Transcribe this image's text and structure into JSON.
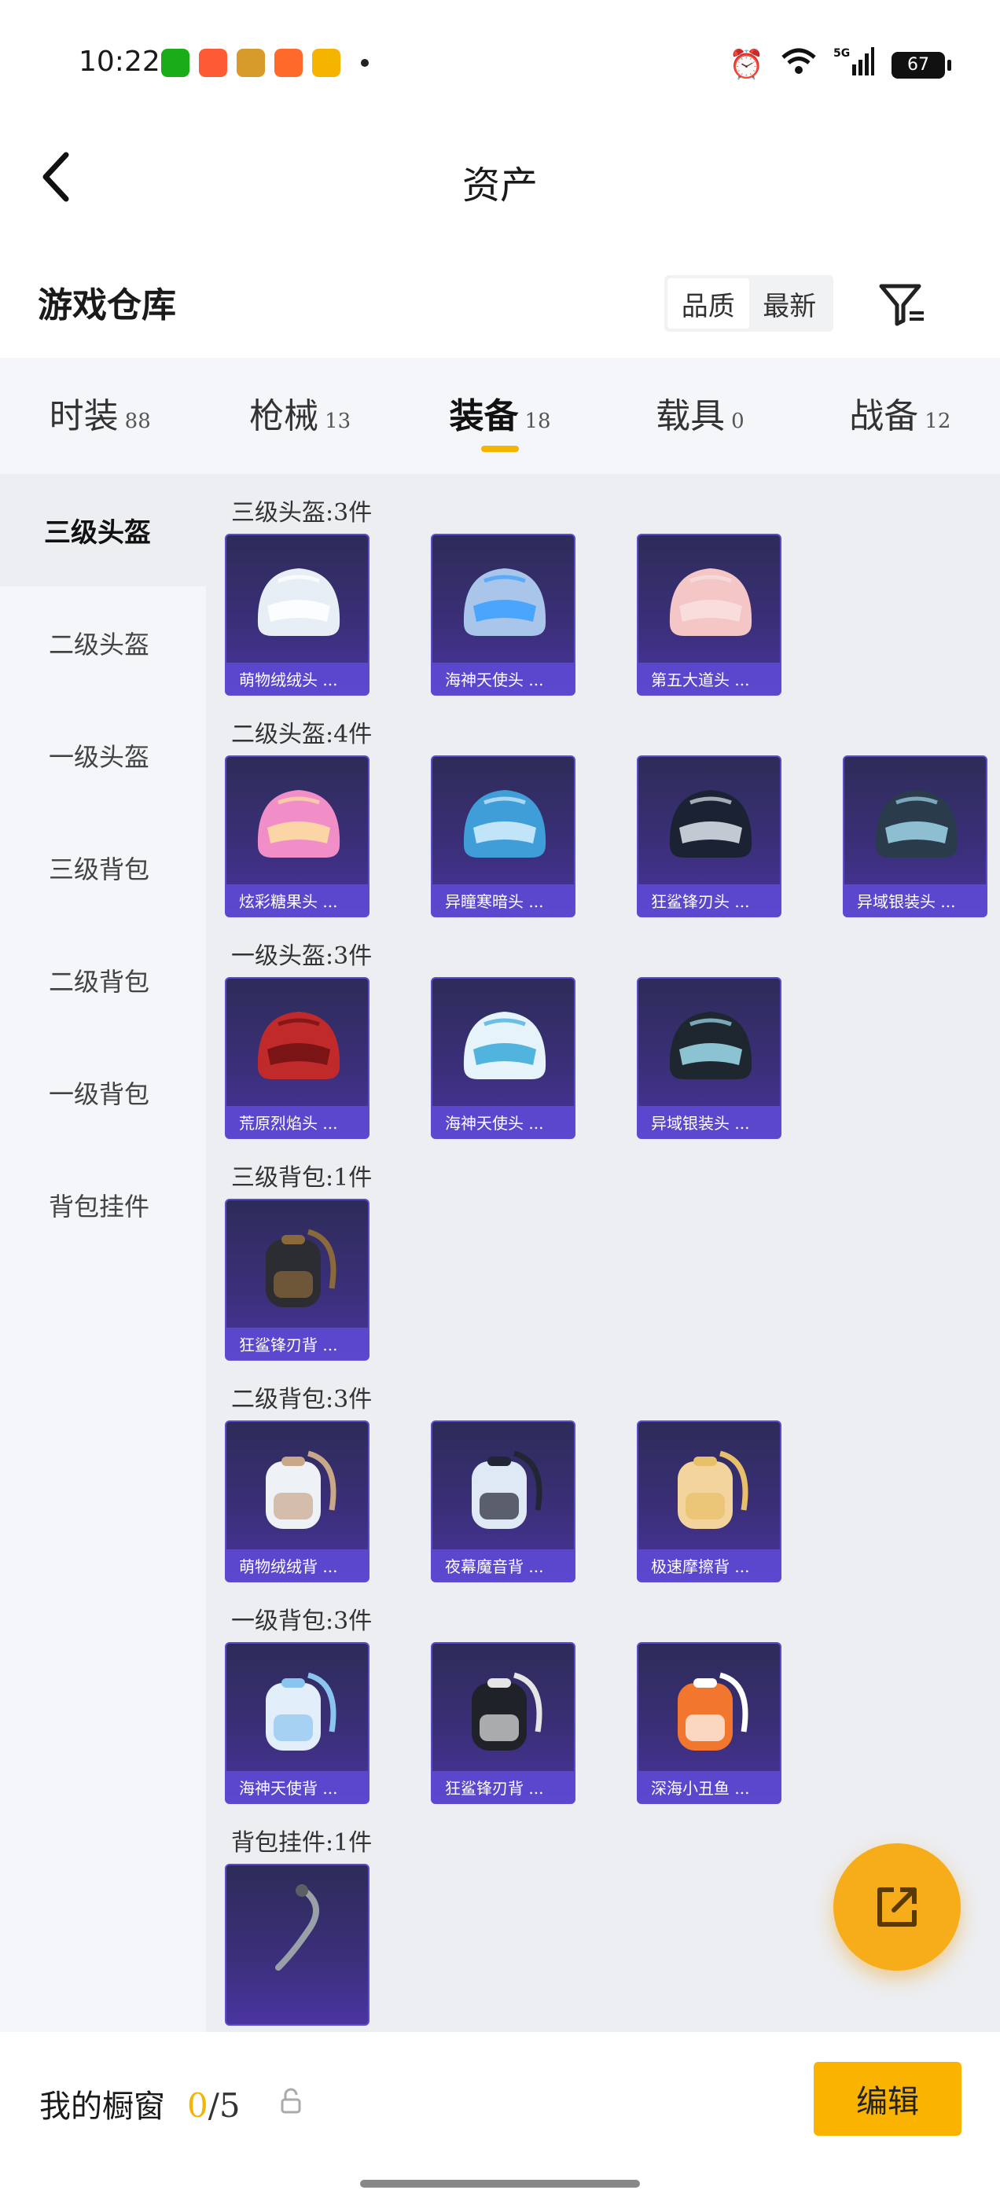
{
  "status_bar": {
    "time": "10:22",
    "battery": "67",
    "notification_icons": [
      {
        "name": "wechat-icon",
        "color": "#1aad19"
      },
      {
        "name": "app-red-icon",
        "color": "#ff5a36"
      },
      {
        "name": "app-game-icon",
        "color": "#d69b2b"
      },
      {
        "name": "app-orange-icon",
        "color": "#ff6a2b"
      },
      {
        "name": "app-yellow-icon",
        "color": "#f5b400"
      }
    ]
  },
  "header": {
    "title": "资产"
  },
  "section": {
    "title": "游戏仓库",
    "sort_options": [
      "品质",
      "最新"
    ],
    "active_sort": 0
  },
  "tabs": [
    {
      "label": "时装",
      "count": "88"
    },
    {
      "label": "枪械",
      "count": "13"
    },
    {
      "label": "装备",
      "count": "18"
    },
    {
      "label": "载具",
      "count": "0"
    },
    {
      "label": "战备",
      "count": "12"
    }
  ],
  "active_tab": 2,
  "sidebar": {
    "items": [
      "三级头盔",
      "二级头盔",
      "一级头盔",
      "三级背包",
      "二级背包",
      "一级背包",
      "背包挂件"
    ],
    "active": 0
  },
  "groups": [
    {
      "title": "三级头盔:3件",
      "items": [
        {
          "label": "萌物绒绒头 ...",
          "color": "#e8eef6",
          "accent": "#ffffff"
        },
        {
          "label": "海神天使头 ...",
          "color": "#a9c6ea",
          "accent": "#3aa0ff"
        },
        {
          "label": "第五大道头 ...",
          "color": "#f4c6c6",
          "accent": "#f9e1e1"
        }
      ]
    },
    {
      "title": "二级头盔:4件",
      "items": [
        {
          "label": "炫彩糖果头 ...",
          "color": "#f18ec8",
          "accent": "#fde2a0"
        },
        {
          "label": "异瞳寒暗头 ...",
          "color": "#3f9ed8",
          "accent": "#d9f0ff"
        },
        {
          "label": "狂鲨锋刃头 ...",
          "color": "#1b2233",
          "accent": "#dfe6ef"
        },
        {
          "label": "异域银装头 ...",
          "color": "#2a3b4c",
          "accent": "#9fd6ea"
        }
      ]
    },
    {
      "title": "一级头盔:3件",
      "items": [
        {
          "label": "荒原烈焰头 ...",
          "color": "#c12a2a",
          "accent": "#6e1010"
        },
        {
          "label": "海神天使头 ...",
          "color": "#e6f3fb",
          "accent": "#35a8d8"
        },
        {
          "label": "异域银装头 ...",
          "color": "#1e2730",
          "accent": "#9fdff0"
        }
      ]
    },
    {
      "title": "三级背包:1件",
      "items": [
        {
          "label": "狂鲨锋刃背 ...",
          "color": "#2b2d33",
          "accent": "#8a6a3a"
        }
      ]
    },
    {
      "title": "二级背包:3件",
      "items": [
        {
          "label": "萌物绒绒背 ...",
          "color": "#eef2f7",
          "accent": "#c9a88a"
        },
        {
          "label": "夜幕魔音背 ...",
          "color": "#dfe8f5",
          "accent": "#222533"
        },
        {
          "label": "极速摩擦背 ...",
          "color": "#f2d49c",
          "accent": "#e9c06a"
        }
      ]
    },
    {
      "title": "一级背包:3件",
      "items": [
        {
          "label": "海神天使背 ...",
          "color": "#e3eefb",
          "accent": "#8cc4f0"
        },
        {
          "label": "狂鲨锋刃背 ...",
          "color": "#1f2228",
          "accent": "#e5e5e5"
        },
        {
          "label": "深海小丑鱼 ...",
          "color": "#f2762e",
          "accent": "#ffffff"
        }
      ]
    },
    {
      "title": "背包挂件:1件",
      "items": [
        {
          "label": "",
          "color": "#9aa0a8",
          "accent": "#5a5f66"
        }
      ]
    }
  ],
  "bottom_bar": {
    "label": "我的橱窗",
    "current": "0",
    "total": "/5",
    "edit_label": "编辑"
  }
}
